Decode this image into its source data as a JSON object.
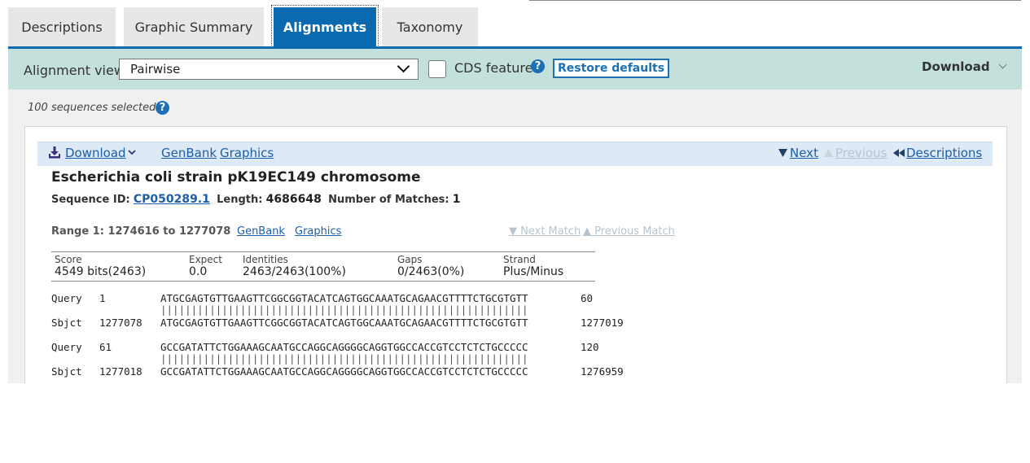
{
  "tabs": [
    {
      "label": "Descriptions"
    },
    {
      "label": "Graphic Summary"
    },
    {
      "label": "Alignments"
    },
    {
      "label": "Taxonomy"
    }
  ],
  "toolbar": {
    "alignment_view_label": "Alignment view",
    "alignment_view_value": "Pairwise",
    "cds_label": "CDS feature",
    "help": "?",
    "restore_label": "Restore defaults",
    "download_label": "Download"
  },
  "selection": {
    "count_text": "100 sequences selected"
  },
  "hitbar": {
    "download_label": "Download",
    "genbank_label": "GenBank",
    "graphics_label": "Graphics",
    "next_label": "Next",
    "previous_label": "Previous",
    "descriptions_label": "Descriptions"
  },
  "hit": {
    "title": "Escherichia coli strain pK19EC149 chromosome",
    "seq_id_label": "Sequence ID:",
    "seq_id": "CP050289.1",
    "length_label": "Length:",
    "length": "4686648",
    "matches_label": "Number of Matches:",
    "matches": "1"
  },
  "range": {
    "text": "Range 1: 1274616 to 1277078",
    "genbank_label": "GenBank",
    "graphics_label": "Graphics",
    "next_match": "▼ Next Match",
    "previous_match": "▲ Previous Match"
  },
  "stats": [
    {
      "header": "Score",
      "value": "4549 bits(2463)"
    },
    {
      "header": "Expect",
      "value": "0.0"
    },
    {
      "header": "Identities",
      "value": "2463/2463(100%)"
    },
    {
      "header": "Gaps",
      "value": "0/2463(0%)"
    },
    {
      "header": "Strand",
      "value": "Plus/Minus"
    }
  ],
  "alignment": [
    {
      "query_label": "Query",
      "query_start": "1",
      "query_seq": "ATGCGAGTGTTGAAGTTCGGCGGTACATCAGTGGCAAATGCAGAACGTTTTCTGCGTGTT",
      "query_end": "60",
      "bars": "||||||||||||||||||||||||||||||||||||||||||||||||||||||||||||",
      "sbjct_label": "Sbjct",
      "sbjct_start": "1277078",
      "sbjct_seq": "ATGCGAGTGTTGAAGTTCGGCGGTACATCAGTGGCAAATGCAGAACGTTTTCTGCGTGTT",
      "sbjct_end": "1277019"
    },
    {
      "query_label": "Query",
      "query_start": "61",
      "query_seq": "GCCGATATTCTGGAAAGCAATGCCAGGCAGGGGCAGGTGGCCACCGTCCTCTCTGCCCCC",
      "query_end": "120",
      "bars": "||||||||||||||||||||||||||||||||||||||||||||||||||||||||||||",
      "sbjct_label": "Sbjct",
      "sbjct_start": "1277018",
      "sbjct_seq": "GCCGATATTCTGGAAAGCAATGCCAGGCAGGGGCAGGTGGCCACCGTCCTCTCTGCCCCC",
      "sbjct_end": "1276959"
    }
  ],
  "colors": {
    "accent": "#0b6aaf",
    "toolbar_bg": "#c3e0dc",
    "link": "#1c5ea8",
    "hitbar_bg": "#dde9f4"
  }
}
